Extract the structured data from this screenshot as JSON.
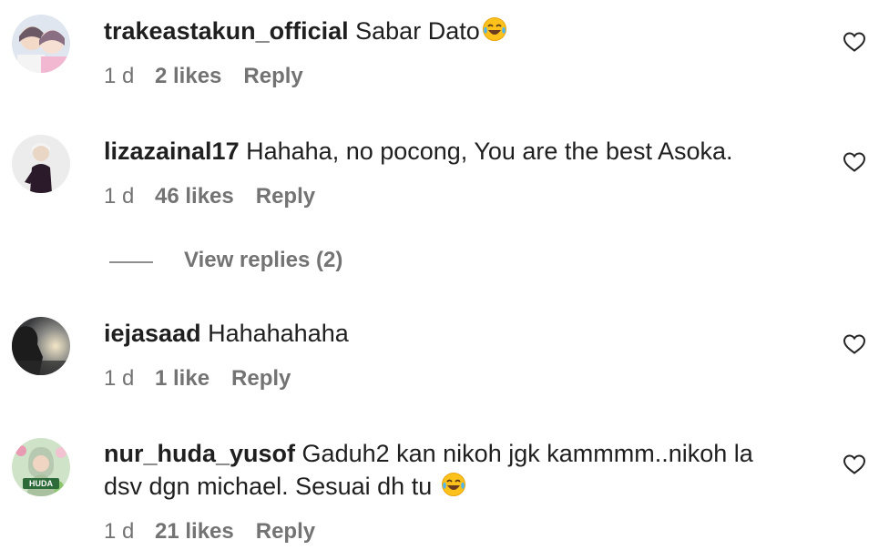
{
  "comments": [
    {
      "username": "trakeastakun_official",
      "text": "Sabar Dato",
      "emoji": "face-with-tears-of-joy",
      "time": "1 d",
      "likes": "2 likes",
      "reply": "Reply"
    },
    {
      "username": "lizazainal17",
      "text": "Hahaha, no pocong, You are the best Asoka.",
      "time": "1 d",
      "likes": "46 likes",
      "reply": "Reply"
    },
    {
      "username": "iejasaad",
      "text": "Hahahahaha",
      "time": "1 d",
      "likes": "1 like",
      "reply": "Reply"
    },
    {
      "username": "nur_huda_yusof",
      "text_line1": "Gaduh2 kan nikoh jgk kammmm..nikoh la",
      "text_line2": "dsv dgn michael. Sesuai dh tu",
      "emoji": "face-with-tears-of-joy",
      "avatar_badge": "HUDA",
      "time": "1 d",
      "likes": "21 likes",
      "reply": "Reply"
    }
  ],
  "view_replies": "View replies (2)",
  "icons": {
    "like": "heart-outline-icon"
  },
  "colors": {
    "text": "#1f1f1f",
    "meta": "#737373",
    "background": "#ffffff"
  }
}
